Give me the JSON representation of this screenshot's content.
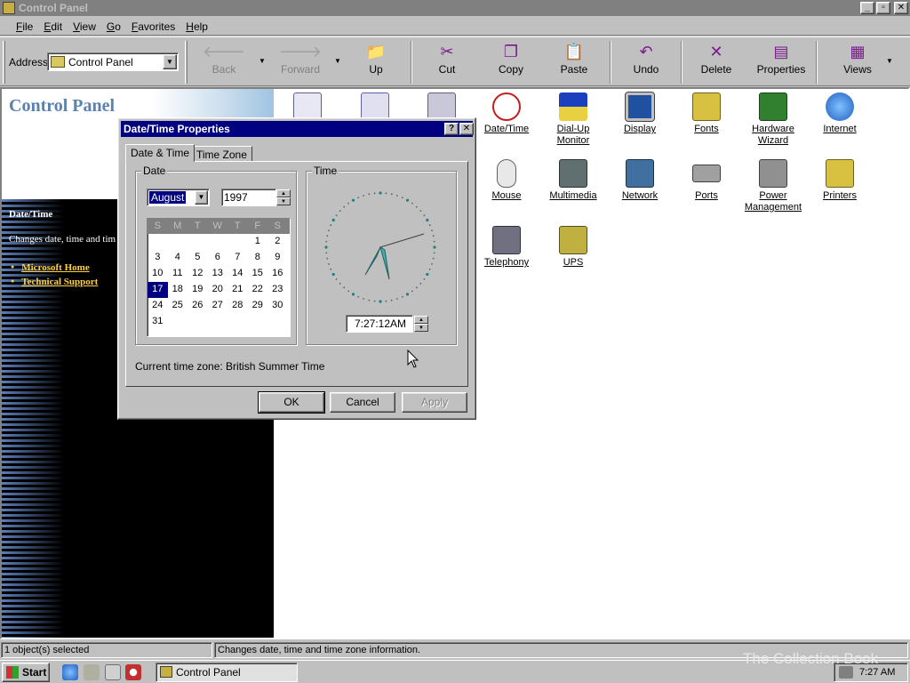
{
  "window": {
    "title": "Control Panel"
  },
  "menu": [
    "File",
    "Edit",
    "View",
    "Go",
    "Favorites",
    "Help"
  ],
  "address": {
    "label": "Address",
    "value": "Control Panel"
  },
  "toolbar": {
    "back": "Back",
    "forward": "Forward",
    "up": "Up",
    "cut": "Cut",
    "copy": "Copy",
    "paste": "Paste",
    "undo": "Undo",
    "delete": "Delete",
    "properties": "Properties",
    "views": "Views"
  },
  "webview": {
    "title": "Control Panel",
    "heading": "Date/Time",
    "desc": "Changes date, time and tim",
    "links": [
      "Microsoft Home",
      "Technical Support"
    ]
  },
  "icons": [
    {
      "label": "Date/Time",
      "color": "#c02020"
    },
    {
      "label": "Dial-Up Monitor",
      "color": "#1a40c0"
    },
    {
      "label": "Display",
      "color": "#2050a0"
    },
    {
      "label": "Fonts",
      "color": "#d8c040"
    },
    {
      "label": "Hardware Wizard",
      "color": "#308030"
    },
    {
      "label": "Internet",
      "color": "#2060c0"
    },
    {
      "label": "Mouse",
      "color": "#d0d0d0"
    },
    {
      "label": "Multimedia",
      "color": "#607070"
    },
    {
      "label": "Network",
      "color": "#4070a0"
    },
    {
      "label": "Ports",
      "color": "#a0a0a0"
    },
    {
      "label": "Power Management",
      "color": "#909090"
    },
    {
      "label": "Printers",
      "color": "#d8c040"
    },
    {
      "label": "Telephony",
      "color": "#707080"
    },
    {
      "label": "UPS",
      "color": "#c0b040"
    }
  ],
  "dialog": {
    "title": "Date/Time Properties",
    "tabs": [
      "Date & Time",
      "Time Zone"
    ],
    "date_group": "Date",
    "time_group": "Time",
    "month": "August",
    "year": "1997",
    "weekdays": [
      "S",
      "M",
      "T",
      "W",
      "T",
      "F",
      "S"
    ],
    "days": [
      "",
      "",
      "",
      "",
      "",
      "1",
      "2",
      "3",
      "4",
      "5",
      "6",
      "7",
      "8",
      "9",
      "10",
      "11",
      "12",
      "13",
      "14",
      "15",
      "16",
      "17",
      "18",
      "19",
      "20",
      "21",
      "22",
      "23",
      "24",
      "25",
      "26",
      "27",
      "28",
      "29",
      "30",
      "31"
    ],
    "selected_day": "17",
    "time": "7:27:12AM",
    "timezone": "Current time zone:  British Summer Time",
    "ok": "OK",
    "cancel": "Cancel",
    "apply": "Apply"
  },
  "status": {
    "left": "1 object(s) selected",
    "right": "Changes date, time and time zone information."
  },
  "taskbar": {
    "start": "Start",
    "task": "Control Panel",
    "clock": "7:27 AM"
  },
  "watermark": "The Collection Book"
}
